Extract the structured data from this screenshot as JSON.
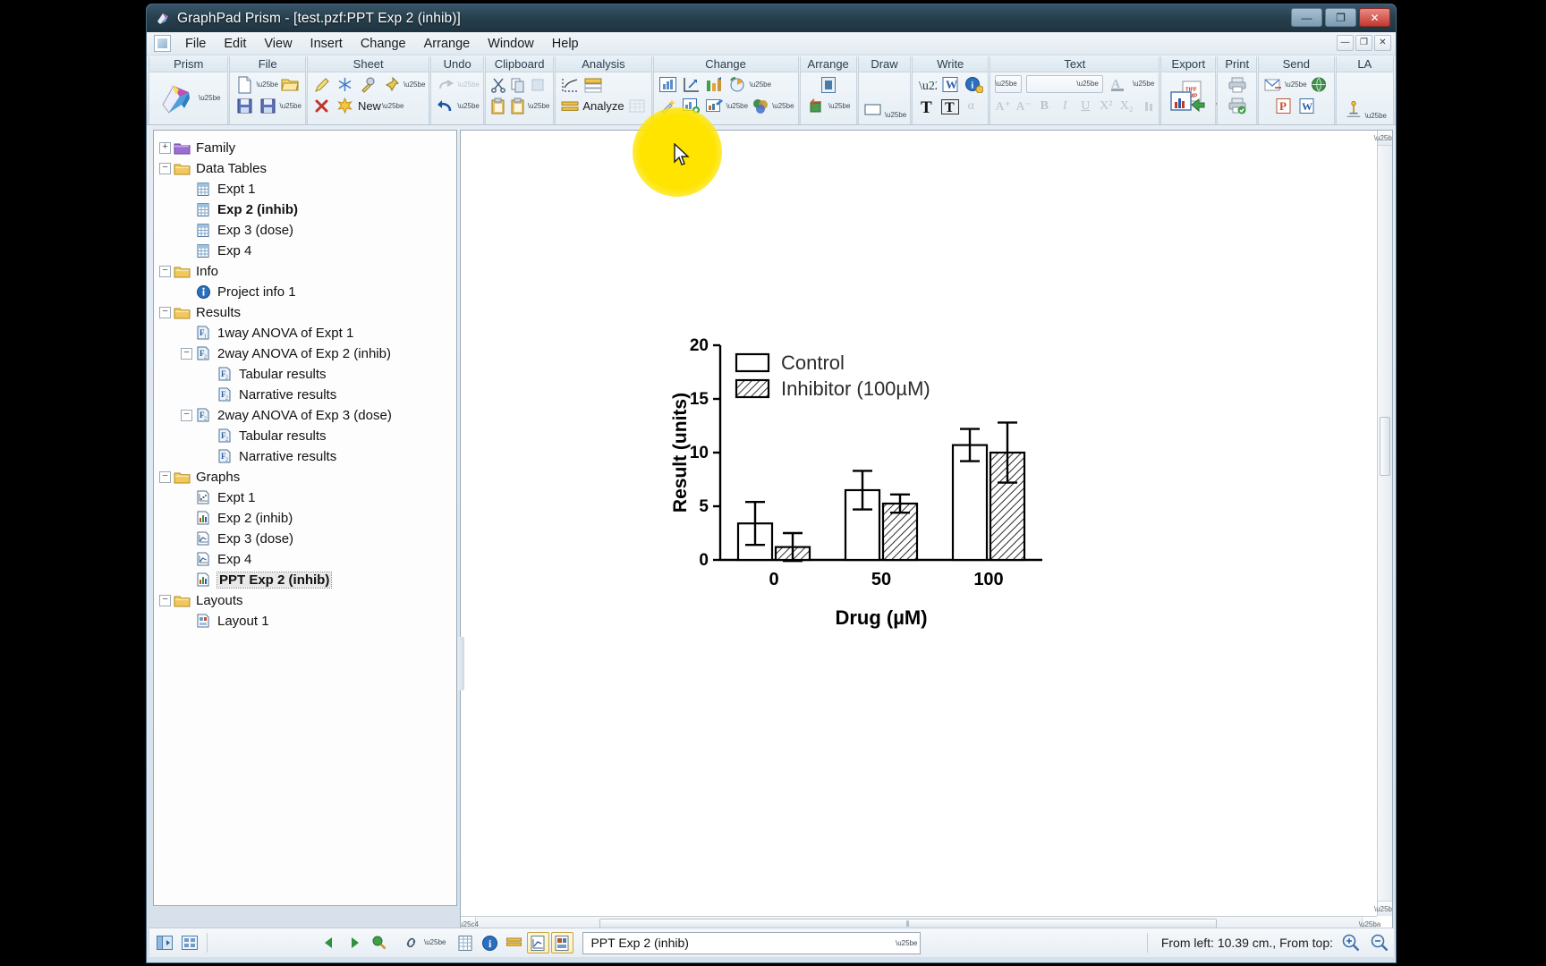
{
  "window": {
    "title": "GraphPad Prism - [test.pzf:PPT Exp 2 (inhib)]",
    "app_icon": "prism-logo-icon",
    "buttons": {
      "minimize": "—",
      "maximize": "❐",
      "close": "✕"
    }
  },
  "menubar": {
    "items": [
      "File",
      "Edit",
      "View",
      "Insert",
      "Change",
      "Arrange",
      "Window",
      "Help"
    ],
    "mdi_buttons": {
      "minimize": "—",
      "restore": "❐",
      "close": "✕"
    }
  },
  "ribbon": {
    "groups": [
      {
        "title": "Prism",
        "name": "prism-group"
      },
      {
        "title": "File",
        "name": "file-group"
      },
      {
        "title": "Sheet",
        "name": "sheet-group",
        "new_label": "New"
      },
      {
        "title": "Undo",
        "name": "undo-group"
      },
      {
        "title": "Clipboard",
        "name": "clipboard-group"
      },
      {
        "title": "Analysis",
        "name": "analysis-group",
        "analyze_label": "Analyze"
      },
      {
        "title": "Change",
        "name": "change-group"
      },
      {
        "title": "Arrange",
        "name": "arrange-group"
      },
      {
        "title": "Draw",
        "name": "draw-group"
      },
      {
        "title": "Write",
        "name": "write-group",
        "alpha_label": "α"
      },
      {
        "title": "Text",
        "name": "text-group"
      },
      {
        "title": "Export",
        "name": "export-group"
      },
      {
        "title": "Print",
        "name": "print-group"
      },
      {
        "title": "Send",
        "name": "send-group"
      },
      {
        "title": "LA",
        "name": "la-group"
      }
    ],
    "text_group": {
      "font_size_value": "",
      "font_name_value": "",
      "buttons": [
        "A⁺",
        "A⁻",
        "B",
        "I",
        "U",
        "X²",
        "X₂"
      ]
    }
  },
  "navigator": {
    "nodes": [
      {
        "label": "Family",
        "icon": "folder-purple-icon",
        "indent": 0,
        "expander": "+",
        "state": "collapsed"
      },
      {
        "label": "Data Tables",
        "icon": "folder-yellow-icon",
        "indent": 0,
        "expander": "−",
        "state": "expanded"
      },
      {
        "label": "Expt 1",
        "icon": "data-table-icon",
        "indent": 1,
        "expander": "",
        "state": ""
      },
      {
        "label": "Exp 2 (inhib)",
        "icon": "data-table-icon",
        "indent": 1,
        "expander": "",
        "state": "bold"
      },
      {
        "label": "Exp 3 (dose)",
        "icon": "data-table-icon",
        "indent": 1,
        "expander": "",
        "state": ""
      },
      {
        "label": "Exp 4",
        "icon": "data-table-icon",
        "indent": 1,
        "expander": "",
        "state": ""
      },
      {
        "label": "Info",
        "icon": "folder-yellow-icon",
        "indent": 0,
        "expander": "−",
        "state": "expanded"
      },
      {
        "label": "Project info 1",
        "icon": "info-circle-icon",
        "indent": 1,
        "expander": "",
        "state": ""
      },
      {
        "label": "Results",
        "icon": "folder-yellow-icon",
        "indent": 0,
        "expander": "−",
        "state": "expanded"
      },
      {
        "label": "1way ANOVA of Expt 1",
        "icon": "results-f1-icon",
        "indent": 1,
        "expander": "",
        "state": ""
      },
      {
        "label": "2way ANOVA of Exp 2 (inhib)",
        "icon": "results-f2-icon",
        "indent": 1,
        "expander": "−",
        "state": "expanded"
      },
      {
        "label": "Tabular results",
        "icon": "results-f2-icon",
        "indent": 2,
        "expander": "",
        "state": ""
      },
      {
        "label": "Narrative results",
        "icon": "results-f2-icon",
        "indent": 2,
        "expander": "",
        "state": ""
      },
      {
        "label": "2way ANOVA of Exp 3 (dose)",
        "icon": "results-f2-icon",
        "indent": 1,
        "expander": "−",
        "state": "expanded"
      },
      {
        "label": "Tabular results",
        "icon": "results-f2-icon",
        "indent": 2,
        "expander": "",
        "state": ""
      },
      {
        "label": "Narrative results",
        "icon": "results-f2-icon",
        "indent": 2,
        "expander": "",
        "state": ""
      },
      {
        "label": "Graphs",
        "icon": "folder-yellow-icon",
        "indent": 0,
        "expander": "−",
        "state": "expanded"
      },
      {
        "label": "Expt 1",
        "icon": "graph-scatter-icon",
        "indent": 1,
        "expander": "",
        "state": ""
      },
      {
        "label": "Exp 2 (inhib)",
        "icon": "graph-bar-icon",
        "indent": 1,
        "expander": "",
        "state": ""
      },
      {
        "label": "Exp 3 (dose)",
        "icon": "graph-line-icon",
        "indent": 1,
        "expander": "",
        "state": ""
      },
      {
        "label": "Exp 4",
        "icon": "graph-line-icon",
        "indent": 1,
        "expander": "",
        "state": ""
      },
      {
        "label": "PPT Exp 2 (inhib)",
        "icon": "graph-bar-icon",
        "indent": 1,
        "expander": "",
        "state": "selected"
      },
      {
        "label": "Layouts",
        "icon": "folder-yellow-icon",
        "indent": 0,
        "expander": "−",
        "state": "expanded"
      },
      {
        "label": "Layout 1",
        "icon": "layout-icon",
        "indent": 1,
        "expander": "",
        "state": ""
      }
    ]
  },
  "statusbar": {
    "sheet_selector_value": "PPT Exp 2 (inhib)",
    "position_text": "From left: 10.39 cm., From top:",
    "nav_prev": "prev-sheet-icon",
    "nav_next": "next-sheet-icon",
    "nav_find": "find-icon",
    "link_icon": "chain-link-icon",
    "zoom_in": "zoom-in-icon",
    "zoom_out": "zoom-out-icon"
  },
  "scrollbars": {
    "h_thumb_grip": "⦀"
  },
  "chart_data": {
    "type": "bar",
    "title": "",
    "xlabel": "Drug (µM)",
    "ylabel": "Result (units)",
    "categories": [
      "0",
      "50",
      "100"
    ],
    "ylim": [
      0,
      20
    ],
    "yticks": [
      0,
      5,
      10,
      15,
      20
    ],
    "grid": false,
    "legend_position": "top-left",
    "error_bars": "SD",
    "series": [
      {
        "name": "Control",
        "fill": "white",
        "pattern": "none",
        "values": [
          3.4,
          6.5,
          10.7
        ],
        "errors": [
          2.0,
          1.8,
          1.5
        ]
      },
      {
        "name": "Inhibitor (100µM)",
        "fill": "white",
        "pattern": "diagonal-hatch",
        "values": [
          1.2,
          5.25,
          10.0
        ],
        "errors": [
          1.3,
          0.85,
          2.8
        ]
      }
    ],
    "colors": {
      "axis": "#000000",
      "bar_stroke": "#000000"
    }
  }
}
